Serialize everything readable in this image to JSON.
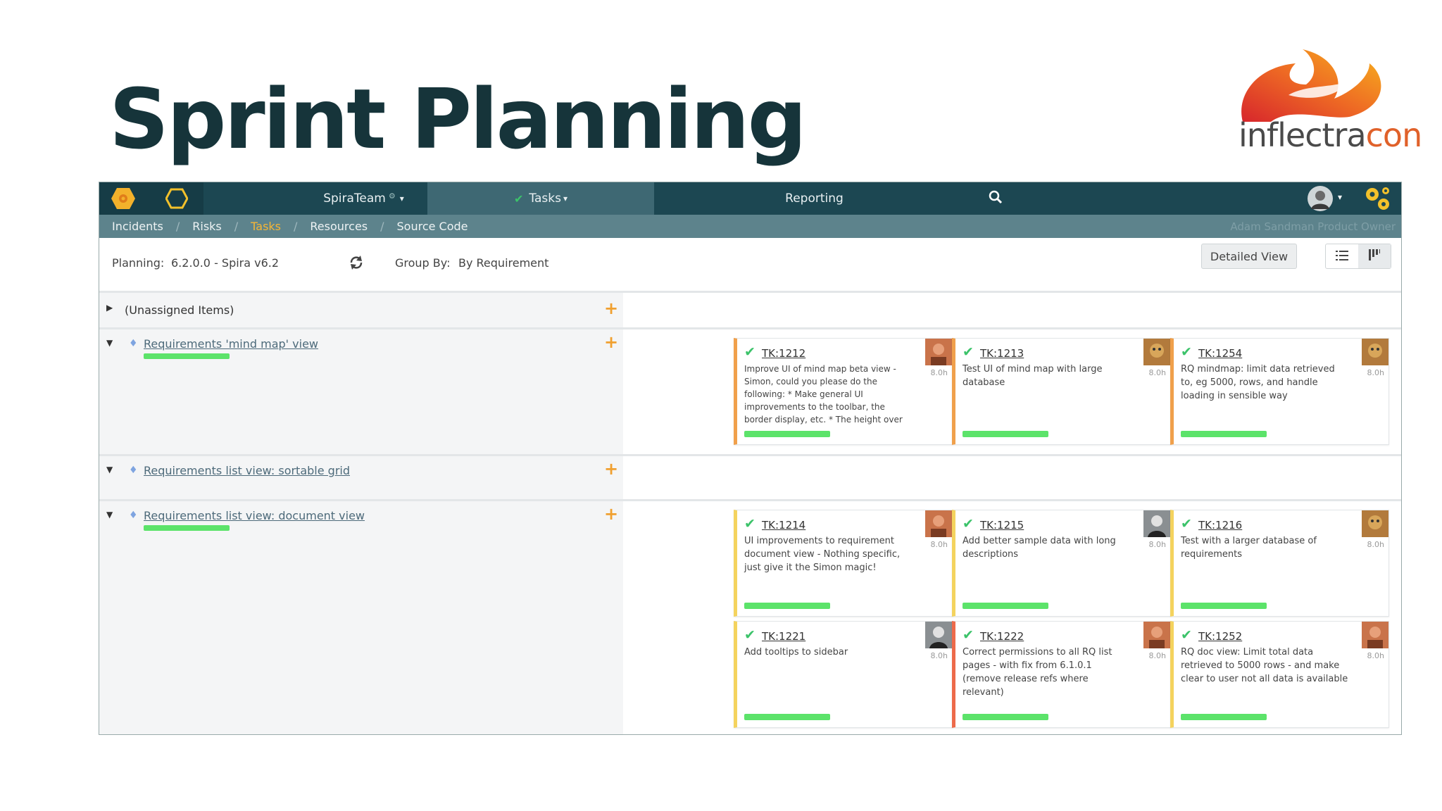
{
  "slide": {
    "title": "Sprint Planning"
  },
  "logo": {
    "text_main": "inflectra",
    "text_accent": "con"
  },
  "topnav": {
    "product": "SpiraTeam",
    "product_gear": "⚙",
    "tasks": "Tasks",
    "reporting": "Reporting",
    "caret": "▾",
    "tasks_check": "✔",
    "icons": [
      "hexagon-logo-icon",
      "hexagon-outline-icon",
      "search-icon",
      "user-avatar-icon",
      "gears-icon"
    ]
  },
  "subnav": {
    "items": [
      "Incidents",
      "Risks",
      "Tasks",
      "Resources",
      "Source Code"
    ],
    "separator": "/",
    "active_index": 2,
    "user": "Adam Sandman Product Owner"
  },
  "toolbar": {
    "planning_label": "Planning:",
    "planning_value": "6.2.0.0 - Spira v6.2",
    "group_by_label": "Group By:",
    "group_by_value": "By Requirement",
    "detailed_view": "Detailed View"
  },
  "groups": [
    {
      "title": "(Unassigned Items)",
      "collapsed": true,
      "plus": "+"
    },
    {
      "title": "Requirements 'mind map' view",
      "plus": "+",
      "progress": 1.0
    },
    {
      "title": "Requirements list view: sortable grid",
      "plus": "+"
    },
    {
      "title": "Requirements list view: document view",
      "plus": "+",
      "progress": 1.0
    }
  ],
  "cards": [
    {
      "id": "TK:1212",
      "hours": "8.0h",
      "color": "orange",
      "desc": "Improve UI of mind map beta view - Simon, could you please do the following: * Make general UI improvements to the toolbar, the border display, etc. * The height over the",
      "progress": 1.0
    },
    {
      "id": "TK:1213",
      "hours": "8.0h",
      "color": "orange",
      "desc": "Test UI of mind map with large database",
      "progress": 1.0
    },
    {
      "id": "TK:1254",
      "hours": "8.0h",
      "color": "orange",
      "desc": "RQ mindmap: limit data retrieved to, eg 5000, rows, and handle loading in sensible way",
      "progress": 1.0
    },
    {
      "id": "TK:1214",
      "hours": "8.0h",
      "color": "yellow",
      "desc": "UI improvements to requirement document view - Nothing specific, just give it the Simon magic!",
      "progress": 1.0
    },
    {
      "id": "TK:1215",
      "hours": "8.0h",
      "color": "yellow",
      "desc": "Add better sample data with long descriptions",
      "progress": 1.0
    },
    {
      "id": "TK:1216",
      "hours": "8.0h",
      "color": "yellow",
      "desc": "Test with a larger database of requirements",
      "progress": 1.0
    },
    {
      "id": "TK:1221",
      "hours": "8.0h",
      "color": "yellow",
      "desc": "Add tooltips to sidebar",
      "progress": 1.0
    },
    {
      "id": "TK:1222",
      "hours": "8.0h",
      "color": "red",
      "desc": "Correct permissions to all RQ list pages - with fix from 6.1.0.1 (remove release refs where relevant)",
      "progress": 1.0
    },
    {
      "id": "TK:1252",
      "hours": "8.0h",
      "color": "yellow",
      "desc": "RQ doc view: Limit total data retrieved to 5000 rows - and make clear to user not all data is available",
      "progress": 1.0
    }
  ],
  "colors": {
    "nav_dark": "#1c4752",
    "nav_active": "#3e6873",
    "subnav": "#5d838c",
    "accent": "#f5b536",
    "progress": "#5ce36a",
    "plus": "#f0a030"
  }
}
